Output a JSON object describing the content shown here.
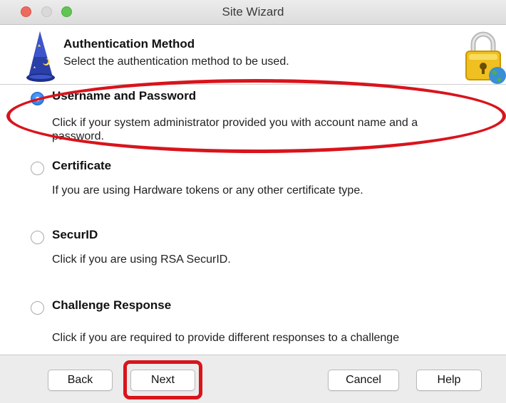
{
  "window": {
    "title": "Site Wizard"
  },
  "header": {
    "title": "Authentication Method",
    "subtitle": "Select the authentication method to be used.",
    "left_icon": "wizard-hat-icon",
    "right_icon": "padlock-globe-icon"
  },
  "options": [
    {
      "title": "Username and Password",
      "desc_line1": "Click if your system administrator provided you with account name and a",
      "desc_line2": "password.",
      "selected": true
    },
    {
      "title": "Certificate",
      "desc_line1": "If you are using Hardware tokens or any other certificate type.",
      "selected": false
    },
    {
      "title": "SecurID",
      "desc_line1": "Click if you are using RSA SecurID.",
      "selected": false
    },
    {
      "title": "Challenge Response",
      "desc_line1": "Click if you are required to provide different responses to a challenge",
      "selected": false
    }
  ],
  "footer": {
    "back_label": "Back",
    "next_label": "Next",
    "cancel_label": "Cancel",
    "help_label": "Help"
  },
  "colors": {
    "annotation_red": "#d8141c",
    "radio_selected_blue": "#1f6fe0"
  }
}
